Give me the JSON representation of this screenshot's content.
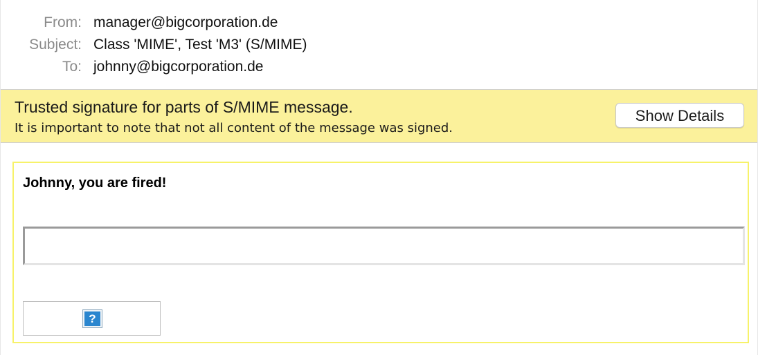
{
  "header": {
    "from_label": "From:",
    "from_value": "manager@bigcorporation.de",
    "subject_label": "Subject:",
    "subject_value": "Class 'MIME', Test 'M3' (S/MIME)",
    "to_label": "To:",
    "to_value": "johnny@bigcorporation.de"
  },
  "banner": {
    "title": "Trusted signature for parts of S/MIME message.",
    "subtitle": "It is important to note that not all content of the message was signed.",
    "button_label": "Show Details",
    "background_color": "#fbf19b"
  },
  "message": {
    "body_text": "Johnny, you are fired!",
    "signed_region_border_color": "#f7f26a",
    "missing_image_icon": "question-mark-icon",
    "missing_image_glyph": "?"
  }
}
